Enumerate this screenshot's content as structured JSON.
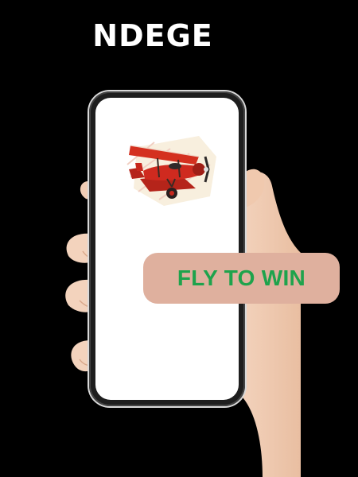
{
  "header": {
    "title": "NDEGE"
  },
  "phone": {
    "screen_image_icon": "red-biplane-icon"
  },
  "cta": {
    "label": "FLY TO WIN"
  },
  "colors": {
    "background": "#000000",
    "title_text": "#ffffff",
    "cta_background": "#dfb09e",
    "cta_text": "#1ea34c",
    "plane_body": "#c8281e"
  }
}
